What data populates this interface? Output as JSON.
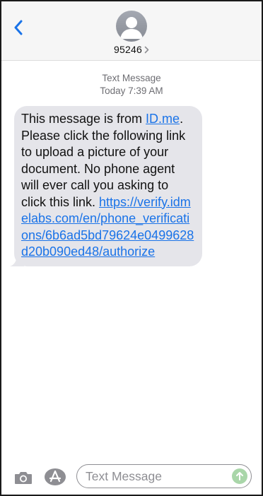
{
  "header": {
    "contact_name": "95246",
    "back_icon": "chevron-left-icon",
    "avatar_icon": "person-silhouette-icon",
    "details_icon": "chevron-right-icon"
  },
  "thread": {
    "message_type": "Text Message",
    "timestamp": "Today 7:39 AM"
  },
  "message": {
    "text_before_link": "This message is from ",
    "sender_link": "ID.me",
    "text_middle": ". Please click the following link to upload a picture of your document. No phone agent will ever call you asking to click this link. ",
    "url": "https://verify.idmelabs.com/en/phone_verifications/6b6ad5bd79624e0499628d20b090ed48/authorize"
  },
  "composer": {
    "placeholder": "Text Message",
    "camera_icon": "camera-icon",
    "apps_icon": "app-store-icon",
    "send_icon": "send-arrow-icon"
  },
  "colors": {
    "accent": "#1a73e8",
    "bubble": "#e5e5ea",
    "header_bg": "#f6f6f6",
    "send_disabled": "#a9d6a9"
  }
}
